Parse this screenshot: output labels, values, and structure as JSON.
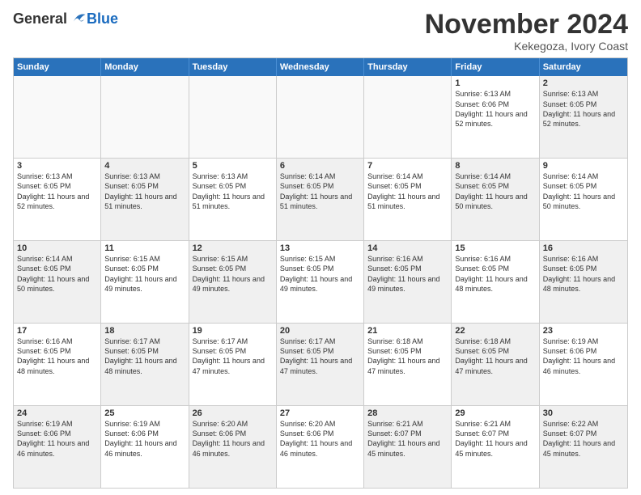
{
  "header": {
    "logo_general": "General",
    "logo_blue": "Blue",
    "month_title": "November 2024",
    "location": "Kekegoza, Ivory Coast"
  },
  "days_of_week": [
    "Sunday",
    "Monday",
    "Tuesday",
    "Wednesday",
    "Thursday",
    "Friday",
    "Saturday"
  ],
  "weeks": [
    [
      {
        "day": "",
        "empty": true
      },
      {
        "day": "",
        "empty": true
      },
      {
        "day": "",
        "empty": true
      },
      {
        "day": "",
        "empty": true
      },
      {
        "day": "",
        "empty": true
      },
      {
        "day": "1",
        "sunrise": "6:13 AM",
        "sunset": "6:06 PM",
        "daylight": "11 hours and 52 minutes."
      },
      {
        "day": "2",
        "sunrise": "6:13 AM",
        "sunset": "6:05 PM",
        "daylight": "11 hours and 52 minutes.",
        "shaded": true
      }
    ],
    [
      {
        "day": "3",
        "sunrise": "6:13 AM",
        "sunset": "6:05 PM",
        "daylight": "11 hours and 52 minutes."
      },
      {
        "day": "4",
        "sunrise": "6:13 AM",
        "sunset": "6:05 PM",
        "daylight": "11 hours and 51 minutes.",
        "shaded": true
      },
      {
        "day": "5",
        "sunrise": "6:13 AM",
        "sunset": "6:05 PM",
        "daylight": "11 hours and 51 minutes."
      },
      {
        "day": "6",
        "sunrise": "6:14 AM",
        "sunset": "6:05 PM",
        "daylight": "11 hours and 51 minutes.",
        "shaded": true
      },
      {
        "day": "7",
        "sunrise": "6:14 AM",
        "sunset": "6:05 PM",
        "daylight": "11 hours and 51 minutes."
      },
      {
        "day": "8",
        "sunrise": "6:14 AM",
        "sunset": "6:05 PM",
        "daylight": "11 hours and 50 minutes.",
        "shaded": true
      },
      {
        "day": "9",
        "sunrise": "6:14 AM",
        "sunset": "6:05 PM",
        "daylight": "11 hours and 50 minutes."
      }
    ],
    [
      {
        "day": "10",
        "sunrise": "6:14 AM",
        "sunset": "6:05 PM",
        "daylight": "11 hours and 50 minutes.",
        "shaded": true
      },
      {
        "day": "11",
        "sunrise": "6:15 AM",
        "sunset": "6:05 PM",
        "daylight": "11 hours and 49 minutes."
      },
      {
        "day": "12",
        "sunrise": "6:15 AM",
        "sunset": "6:05 PM",
        "daylight": "11 hours and 49 minutes.",
        "shaded": true
      },
      {
        "day": "13",
        "sunrise": "6:15 AM",
        "sunset": "6:05 PM",
        "daylight": "11 hours and 49 minutes."
      },
      {
        "day": "14",
        "sunrise": "6:16 AM",
        "sunset": "6:05 PM",
        "daylight": "11 hours and 49 minutes.",
        "shaded": true
      },
      {
        "day": "15",
        "sunrise": "6:16 AM",
        "sunset": "6:05 PM",
        "daylight": "11 hours and 48 minutes."
      },
      {
        "day": "16",
        "sunrise": "6:16 AM",
        "sunset": "6:05 PM",
        "daylight": "11 hours and 48 minutes.",
        "shaded": true
      }
    ],
    [
      {
        "day": "17",
        "sunrise": "6:16 AM",
        "sunset": "6:05 PM",
        "daylight": "11 hours and 48 minutes."
      },
      {
        "day": "18",
        "sunrise": "6:17 AM",
        "sunset": "6:05 PM",
        "daylight": "11 hours and 48 minutes.",
        "shaded": true
      },
      {
        "day": "19",
        "sunrise": "6:17 AM",
        "sunset": "6:05 PM",
        "daylight": "11 hours and 47 minutes."
      },
      {
        "day": "20",
        "sunrise": "6:17 AM",
        "sunset": "6:05 PM",
        "daylight": "11 hours and 47 minutes.",
        "shaded": true
      },
      {
        "day": "21",
        "sunrise": "6:18 AM",
        "sunset": "6:05 PM",
        "daylight": "11 hours and 47 minutes."
      },
      {
        "day": "22",
        "sunrise": "6:18 AM",
        "sunset": "6:05 PM",
        "daylight": "11 hours and 47 minutes.",
        "shaded": true
      },
      {
        "day": "23",
        "sunrise": "6:19 AM",
        "sunset": "6:06 PM",
        "daylight": "11 hours and 46 minutes."
      }
    ],
    [
      {
        "day": "24",
        "sunrise": "6:19 AM",
        "sunset": "6:06 PM",
        "daylight": "11 hours and 46 minutes.",
        "shaded": true
      },
      {
        "day": "25",
        "sunrise": "6:19 AM",
        "sunset": "6:06 PM",
        "daylight": "11 hours and 46 minutes."
      },
      {
        "day": "26",
        "sunrise": "6:20 AM",
        "sunset": "6:06 PM",
        "daylight": "11 hours and 46 minutes.",
        "shaded": true
      },
      {
        "day": "27",
        "sunrise": "6:20 AM",
        "sunset": "6:06 PM",
        "daylight": "11 hours and 46 minutes."
      },
      {
        "day": "28",
        "sunrise": "6:21 AM",
        "sunset": "6:07 PM",
        "daylight": "11 hours and 45 minutes.",
        "shaded": true
      },
      {
        "day": "29",
        "sunrise": "6:21 AM",
        "sunset": "6:07 PM",
        "daylight": "11 hours and 45 minutes."
      },
      {
        "day": "30",
        "sunrise": "6:22 AM",
        "sunset": "6:07 PM",
        "daylight": "11 hours and 45 minutes.",
        "shaded": true
      }
    ]
  ]
}
